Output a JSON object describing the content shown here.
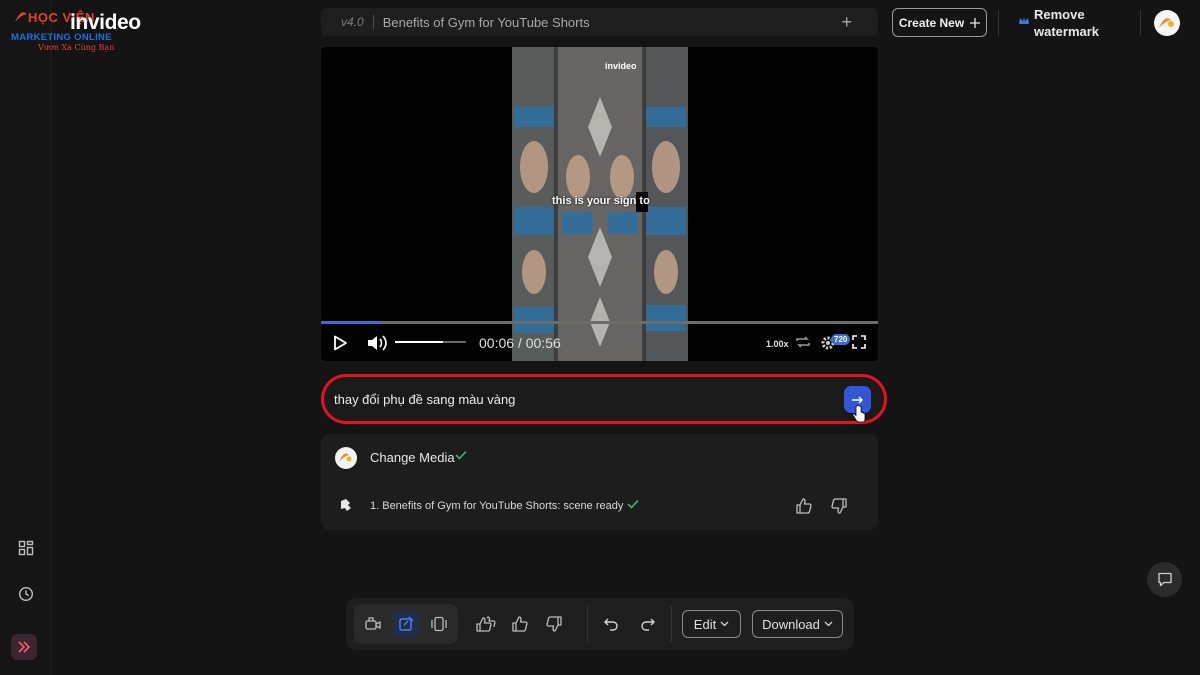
{
  "brand": {
    "overlay_line1": "HỌC VIỆN",
    "overlay_line2": "MARKETING ONLINE",
    "overlay_line3": "Vươn Xa Cùng Bạn",
    "app_name": "invideo"
  },
  "header": {
    "version": "v4.0",
    "project_title": "Benefits of Gym for YouTube Shorts",
    "new_tab": "+",
    "create_new": "Create New",
    "remove_watermark_line1": "Remove",
    "remove_watermark_line2": "watermark"
  },
  "player": {
    "watermark": "invideo",
    "caption": "this is your sign to",
    "time": "00:06 / 00:56",
    "progress_fraction": 0.107,
    "volume_fraction": 0.68,
    "speed": "1.00x",
    "quality": "720"
  },
  "prompt": {
    "value": "thay đổi phụ đề sang màu vàng"
  },
  "chat": {
    "action_label": "Change Media",
    "scene_status": "1. Benefits of Gym for YouTube Shorts: scene ready"
  },
  "toolbar": {
    "edit_label": "Edit",
    "download_label": "Download"
  },
  "colors": {
    "accent_blue": "#3556d4",
    "highlight_red": "#e0141e",
    "success_green": "#3fbf6f"
  },
  "icons": [
    "grid-icon",
    "history-icon",
    "expand-sidebar-icon",
    "play-icon",
    "volume-icon",
    "loop-icon",
    "settings-gear-icon",
    "fullscreen-icon",
    "send-arrow-icon",
    "check-icon",
    "thumbs-up-icon",
    "thumbs-down-icon",
    "undo-icon",
    "redo-icon",
    "chat-feedback-icon",
    "crown-icon"
  ]
}
